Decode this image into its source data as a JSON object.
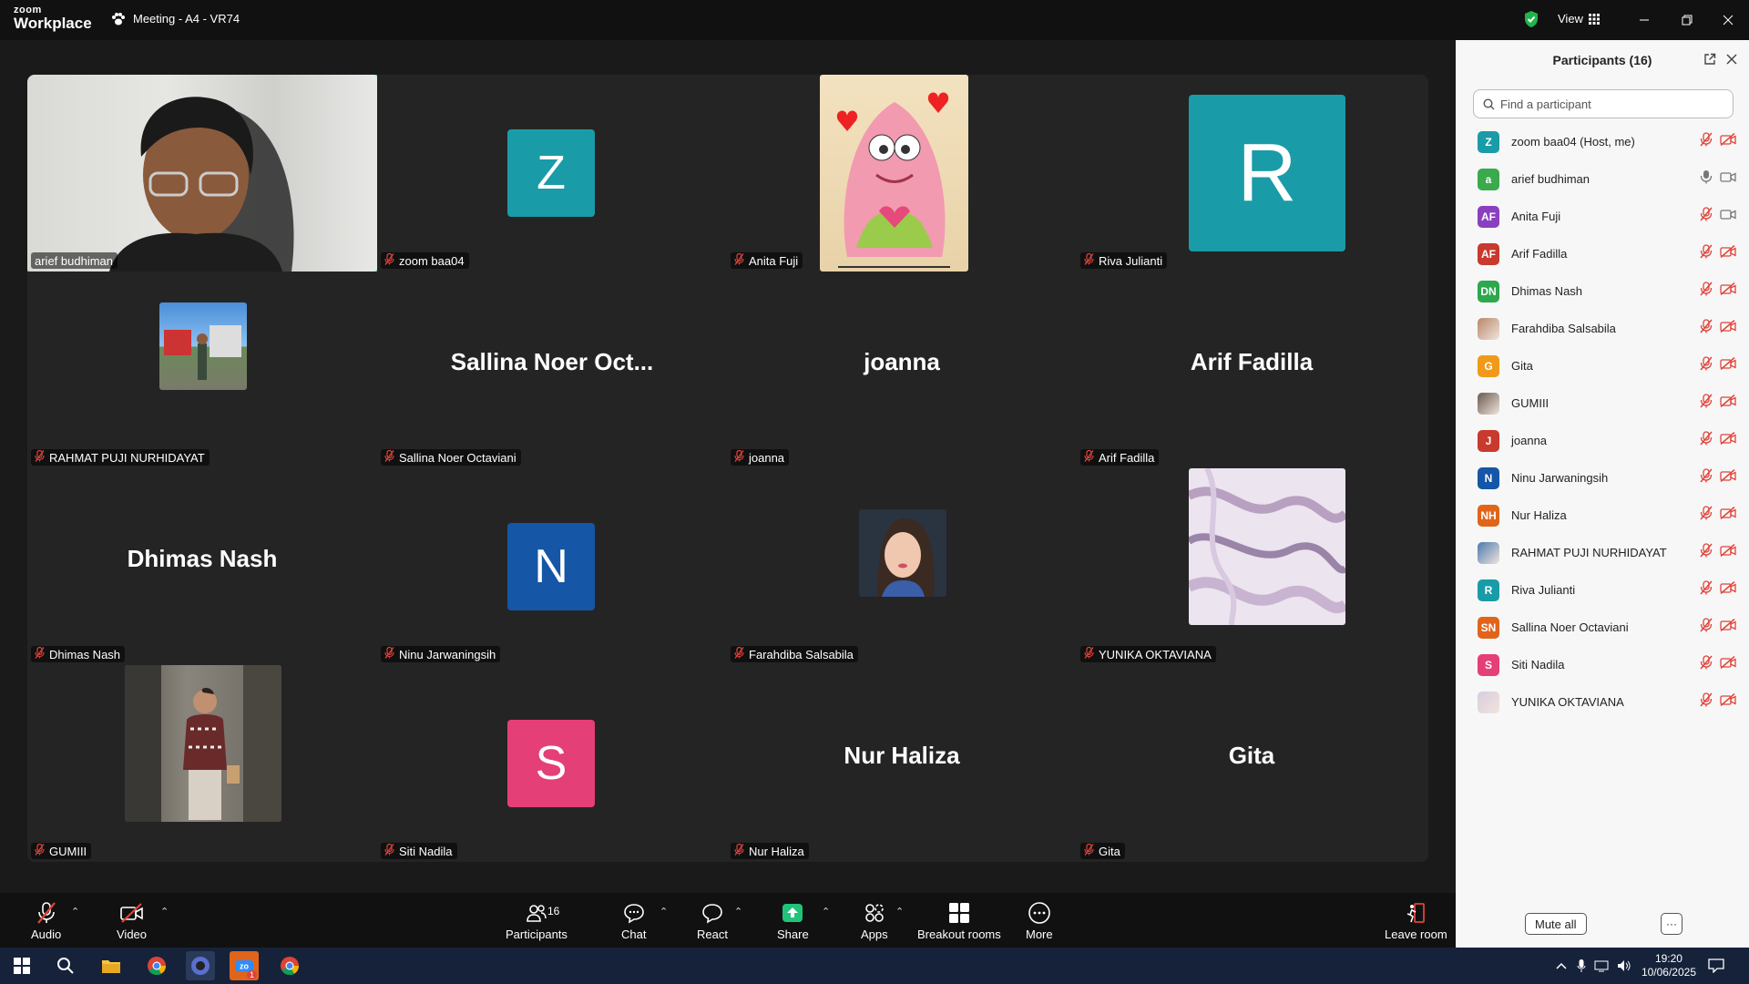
{
  "titlebar": {
    "logo_top": "zoom",
    "logo_bottom": "Workplace",
    "meeting_title": "Meeting - A4 - VR74",
    "view_label": "View"
  },
  "tiles": [
    {
      "name": "arief budhiman",
      "kind": "photo",
      "active": true
    },
    {
      "name": "zoom baa04",
      "kind": "letter",
      "letter": "Z",
      "color": "#1a9ba8"
    },
    {
      "name": "Anita Fuji",
      "kind": "patrick"
    },
    {
      "name": "Riva Julianti",
      "kind": "bigletter",
      "letter": "R",
      "color": "#1a9ba8"
    },
    {
      "name": "RAHMAT PUJI NURHIDAYAT",
      "kind": "smallphoto"
    },
    {
      "name": "Sallina Noer Octaviani",
      "kind": "text",
      "display": "Sallina Noer Oct..."
    },
    {
      "name": "joanna",
      "kind": "text",
      "display": "joanna"
    },
    {
      "name": "Arif Fadilla",
      "kind": "text",
      "display": "Arif Fadilla"
    },
    {
      "name": "Dhimas Nash",
      "kind": "text",
      "display": "Dhimas Nash"
    },
    {
      "name": "Ninu Jarwaningsih",
      "kind": "letter",
      "letter": "N",
      "color": "#1556a6"
    },
    {
      "name": "Farahdiba Salsabila",
      "kind": "selfie"
    },
    {
      "name": "YUNIKA OKTAVIANA",
      "kind": "marble"
    },
    {
      "name": "GUMIII",
      "kind": "streetphoto"
    },
    {
      "name": "Siti Nadila",
      "kind": "letter",
      "letter": "S",
      "color": "#e43f76"
    },
    {
      "name": "Nur Haliza",
      "kind": "text",
      "display": "Nur Haliza"
    },
    {
      "name": "Gita",
      "kind": "text",
      "display": "Gita"
    }
  ],
  "sidebar": {
    "title": "Participants (16)",
    "search_placeholder": "Find a participant",
    "participants": [
      {
        "initials": "Z",
        "name": "zoom baa04 (Host, me)",
        "color": "#1a9ba8",
        "mic": "muted",
        "video": "off"
      },
      {
        "initials": "a",
        "name": "arief budhiman",
        "color": "#3aaa4c",
        "mic": "on",
        "video": "on"
      },
      {
        "initials": "AF",
        "name": "Anita Fuji",
        "color": "#8a3fc0",
        "mic": "muted",
        "video": "on"
      },
      {
        "initials": "AF",
        "name": "Arif Fadilla",
        "color": "#c8392e",
        "mic": "muted",
        "video": "off"
      },
      {
        "initials": "DN",
        "name": "Dhimas Nash",
        "color": "#2ea74d",
        "mic": "muted",
        "video": "off"
      },
      {
        "initials": "",
        "name": "Farahdiba Salsabila",
        "color": "#b8876a",
        "mic": "muted",
        "video": "off"
      },
      {
        "initials": "G",
        "name": "Gita",
        "color": "#f09a1a",
        "mic": "muted",
        "video": "off"
      },
      {
        "initials": "",
        "name": "GUMIII",
        "color": "#6a5a50",
        "mic": "muted",
        "video": "off"
      },
      {
        "initials": "J",
        "name": "joanna",
        "color": "#c8392e",
        "mic": "muted",
        "video": "off"
      },
      {
        "initials": "N",
        "name": "Ninu Jarwaningsih",
        "color": "#1556a6",
        "mic": "muted",
        "video": "off"
      },
      {
        "initials": "NH",
        "name": "Nur Haliza",
        "color": "#e0641a",
        "mic": "muted",
        "video": "off"
      },
      {
        "initials": "",
        "name": "RAHMAT PUJI NURHIDAYAT",
        "color": "#4a7ab0",
        "mic": "muted",
        "video": "off"
      },
      {
        "initials": "R",
        "name": "Riva Julianti",
        "color": "#1a9ba8",
        "mic": "muted",
        "video": "off"
      },
      {
        "initials": "SN",
        "name": "Sallina Noer Octaviani",
        "color": "#e0641a",
        "mic": "muted",
        "video": "off"
      },
      {
        "initials": "S",
        "name": "Siti Nadila",
        "color": "#e43f76",
        "mic": "muted",
        "video": "off"
      },
      {
        "initials": "",
        "name": "YUNIKA OKTAVIANA",
        "color": "#d8ccdf",
        "mic": "muted",
        "video": "off"
      }
    ],
    "mute_all": "Mute all",
    "more": "···"
  },
  "toolbar": {
    "audio": "Audio",
    "video": "Video",
    "participants": "Participants",
    "participants_count": "16",
    "chat": "Chat",
    "react": "React",
    "share": "Share",
    "apps": "Apps",
    "breakout": "Breakout rooms",
    "more": "More",
    "leave": "Leave room"
  },
  "taskbar": {
    "time": "19:20",
    "date": "10/06/2025",
    "zoom_badge": "1"
  },
  "colors": {
    "active_border": "#2ecf8c",
    "muted_red": "#e0433a",
    "share_green": "#21c37a"
  }
}
